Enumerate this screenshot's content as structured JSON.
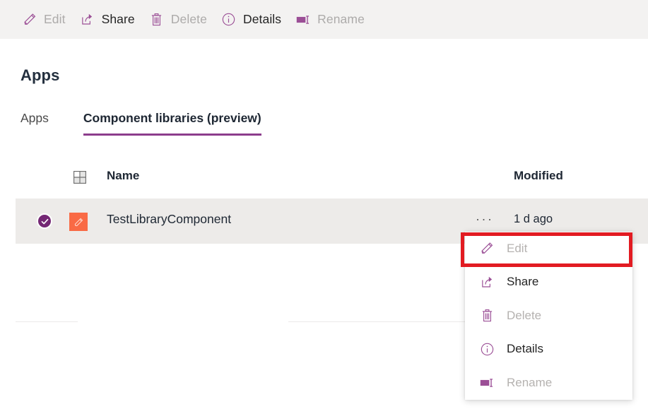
{
  "commandbar": {
    "items": [
      {
        "label": "Edit",
        "icon": "pencil-icon",
        "enabled": false
      },
      {
        "label": "Share",
        "icon": "share-icon",
        "enabled": true
      },
      {
        "label": "Delete",
        "icon": "trash-icon",
        "enabled": false
      },
      {
        "label": "Details",
        "icon": "info-icon",
        "enabled": true
      },
      {
        "label": "Rename",
        "icon": "rename-icon",
        "enabled": false
      }
    ]
  },
  "page": {
    "title": "Apps"
  },
  "tabs": [
    {
      "label": "Apps",
      "active": false
    },
    {
      "label": "Component libraries (preview)",
      "active": true
    }
  ],
  "list": {
    "header": {
      "grid_icon": "component-grid-icon",
      "name": "Name",
      "modified": "Modified"
    },
    "rows": [
      {
        "selected": true,
        "check_icon": "checkmark-circle-icon",
        "thumb_icon": "app-pencil-thumbnail",
        "name": "TestLibraryComponent",
        "overflow": "···",
        "modified": "1 d ago"
      }
    ]
  },
  "context_menu": {
    "items": [
      {
        "label": "Edit",
        "icon": "pencil-icon",
        "enabled": false,
        "highlighted": true
      },
      {
        "label": "Share",
        "icon": "share-icon",
        "enabled": true,
        "highlighted": false
      },
      {
        "label": "Delete",
        "icon": "trash-icon",
        "enabled": false,
        "highlighted": false
      },
      {
        "label": "Details",
        "icon": "info-icon",
        "enabled": true,
        "highlighted": false
      },
      {
        "label": "Rename",
        "icon": "rename-icon",
        "enabled": false,
        "highlighted": false
      }
    ]
  },
  "colors": {
    "accent_purple": "#8c3d8c",
    "icon_purple": "#9b4f96",
    "check_purple": "#742774",
    "thumb_orange": "#f96a45",
    "annotation_red": "#e21b22",
    "commandbar_bg": "#f3f2f1",
    "row_selected_bg": "#edebe9"
  }
}
